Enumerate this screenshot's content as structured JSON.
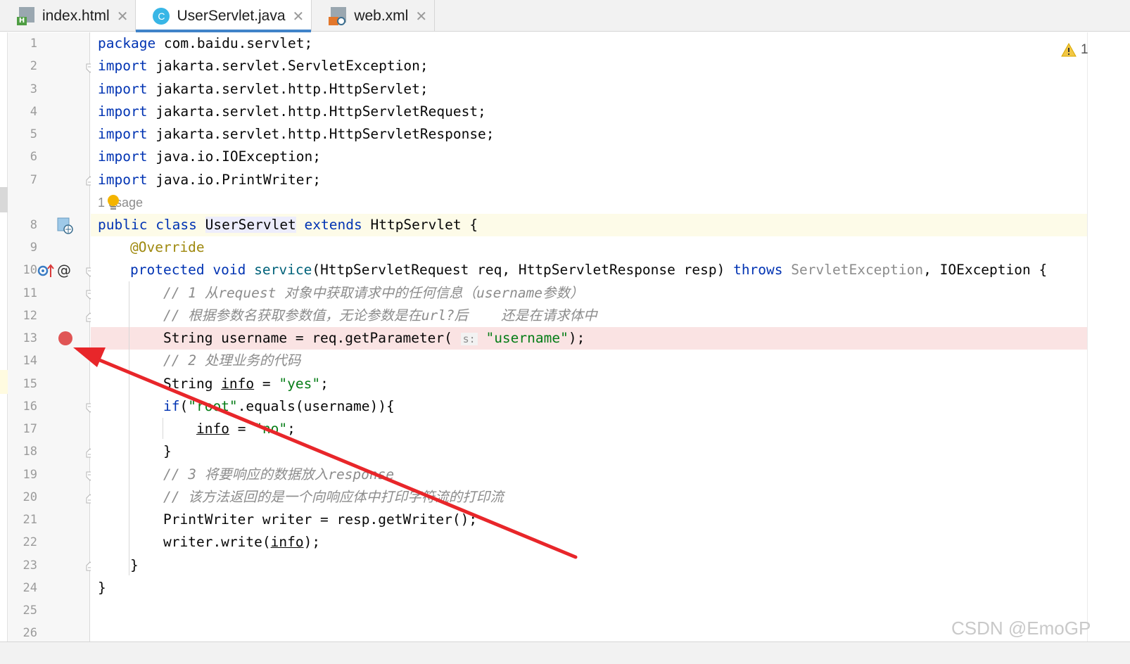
{
  "tabs": [
    {
      "label": "index.html",
      "icon": "html-file-icon",
      "active": false
    },
    {
      "label": "UserServlet.java",
      "icon": "java-class-icon",
      "active": true
    },
    {
      "label": "web.xml",
      "icon": "xml-file-icon",
      "active": false
    }
  ],
  "tab_close_glyph": "✕",
  "inspections": {
    "warning_count": "1",
    "icon": "warning-triangle-icon"
  },
  "gutter": {
    "line_numbers": [
      "1",
      "2",
      "3",
      "4",
      "5",
      "6",
      "7",
      "8",
      "9",
      "10",
      "11",
      "12",
      "13",
      "14",
      "15",
      "16",
      "17",
      "18",
      "19",
      "20",
      "21",
      "22",
      "23",
      "24",
      "25",
      "26"
    ],
    "override_marker": "@",
    "breakpoint_line": "13",
    "breakpoint_color": "#e05555"
  },
  "code": {
    "usage_hint": "1 usage",
    "line1": {
      "kw": "package",
      "rest": " com.baidu.servlet;"
    },
    "import_kw": "import",
    "imports": [
      " jakarta.servlet.ServletException;",
      " jakarta.servlet.http.HttpServlet;",
      " jakarta.servlet.http.HttpServletRequest;",
      " jakarta.servlet.http.HttpServletResponse;",
      " java.io.IOException;",
      " java.io.PrintWriter;"
    ],
    "class_line": {
      "kw1": "public",
      "kw2": "class",
      "name": "UserServlet",
      "kw3": "extends",
      "parent": " HttpServlet {"
    },
    "annotation": "@Override",
    "method_line": {
      "kw1": "protected",
      "kw2": "void",
      "name": "service",
      "params": "(HttpServletRequest req, HttpServletResponse resp) ",
      "kw3": "throws",
      "ex1": "ServletException",
      "ex2": ", IOException {"
    },
    "comment1": "// 1 从request 对象中获取请求中的任何信息（username参数）",
    "comment2": "// 根据参数名获取参数值，无论参数是在url?后    还是在请求体中",
    "line13": {
      "pre": "String username = req.getParameter( ",
      "hint": "s:",
      "str": "\"username\"",
      "post": ");"
    },
    "comment3": "// 2 处理业务的代码",
    "line15": {
      "pre": "String ",
      "var": "info",
      "mid": " = ",
      "str": "\"yes\"",
      "post": ";"
    },
    "line16": {
      "kw": "if",
      "p1": "(",
      "str": "\"root\"",
      "rest": ".equals(username)){"
    },
    "line17": {
      "var": "info",
      "mid": " = ",
      "str": "\"no\"",
      "post": ";"
    },
    "close_brace": "}",
    "comment4": "// 3 将要响应的数据放入response",
    "comment5": "// 该方法返回的是一个向响应体中打印字符流的打印流",
    "line21": "PrintWriter writer = resp.getWriter();",
    "line22": {
      "pre": "writer.write(",
      "var": "info",
      "post": ");"
    }
  },
  "watermark": "CSDN @EmoGP",
  "annotation_arrow_color": "#e8262a"
}
